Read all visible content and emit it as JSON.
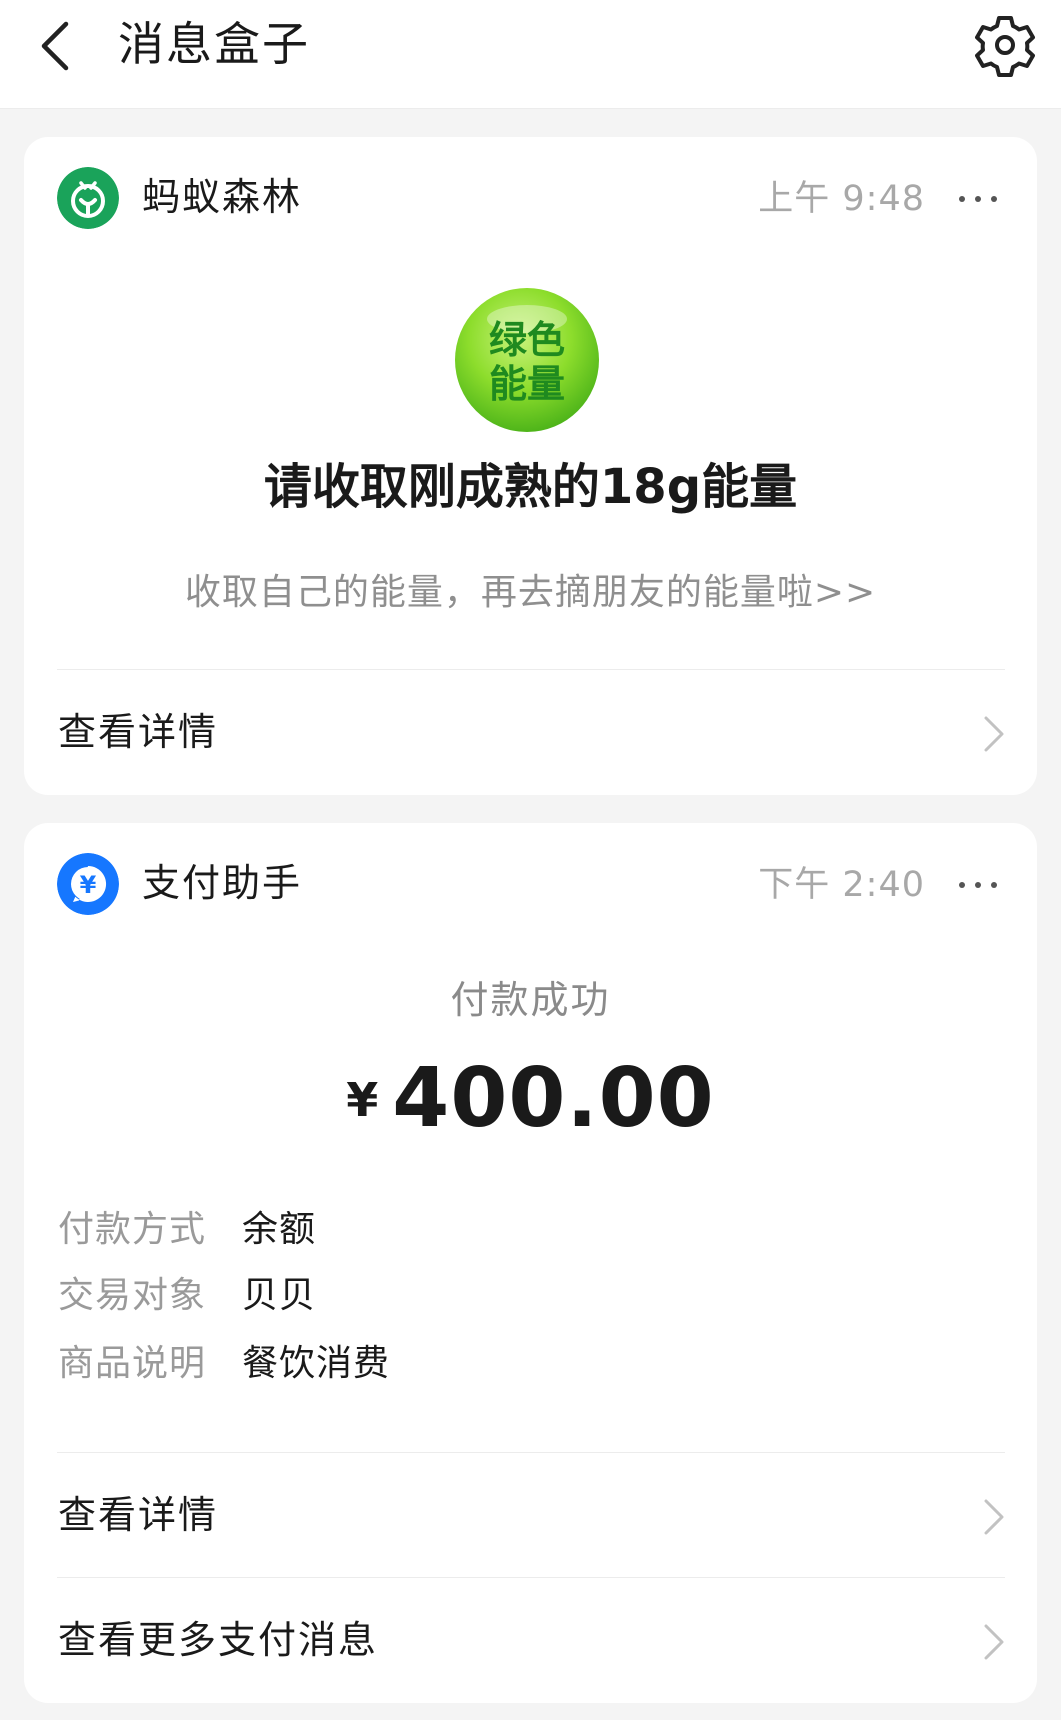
{
  "header": {
    "title": "消息盒子",
    "back_icon": "chevron-left-icon",
    "settings_icon": "gear-icon"
  },
  "cards": [
    {
      "app_name": "蚂蚁森林",
      "time": "上午 9:48",
      "avatar_color": "#1aa35a",
      "badge_text": "绿色\n能量",
      "title": "请收取刚成熟的18g能量",
      "subtitle": "收取自己的能量，再去摘朋友的能量啦>>",
      "links": [
        "查看详情"
      ]
    },
    {
      "app_name": "支付助手",
      "time": "下午 2:40",
      "avatar_color": "#1677ff",
      "status": "付款成功",
      "currency": "¥",
      "amount": "400.00",
      "details": [
        {
          "label": "付款方式",
          "value": "余额"
        },
        {
          "label": "交易对象",
          "value": "贝贝"
        },
        {
          "label": "商品说明",
          "value": "餐饮消费"
        }
      ],
      "links": [
        "查看详情",
        "查看更多支付消息"
      ]
    }
  ],
  "colors": {
    "background": "#f4f4f4",
    "card": "#ffffff",
    "energy_green": "#7ed321",
    "energy_text": "#1d8a1d",
    "muted_text": "#9a9a9a"
  }
}
